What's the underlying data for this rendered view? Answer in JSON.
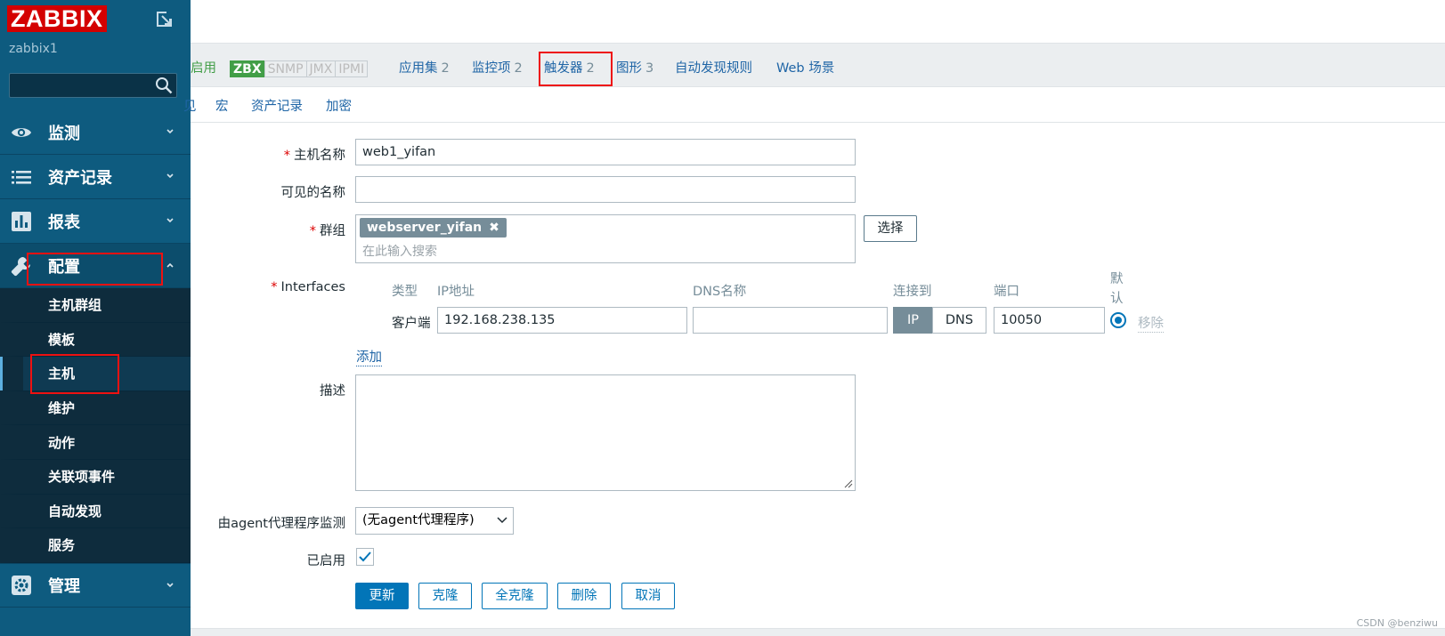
{
  "sidebar": {
    "logo": "ZABBIX",
    "server_name": "zabbix1",
    "search_placeholder": "",
    "menu": [
      {
        "label": "监测",
        "icon": "eye-icon"
      },
      {
        "label": "资产记录",
        "icon": "list-icon"
      },
      {
        "label": "报表",
        "icon": "bar-chart-icon"
      },
      {
        "label": "配置",
        "icon": "wrench-icon"
      },
      {
        "label": "管理",
        "icon": "gear-icon"
      }
    ],
    "config_submenu": [
      "主机群组",
      "模板",
      "主机",
      "维护",
      "动作",
      "关联项事件",
      "自动发现",
      "服务"
    ],
    "selected_submenu": "主机"
  },
  "tabs_row1": {
    "enabled_text": "启用",
    "availability": [
      "ZBX",
      "SNMP",
      "JMX",
      "IPMI"
    ],
    "items": [
      {
        "label": "应用集",
        "count": "2"
      },
      {
        "label": "监控项",
        "count": "2"
      },
      {
        "label": "触发器",
        "count": "2"
      },
      {
        "label": "图形",
        "count": "3"
      },
      {
        "label": "自动发现规则",
        "count": ""
      },
      {
        "label": "Web 场景",
        "count": ""
      }
    ]
  },
  "tabs_row2": {
    "partial": "见",
    "items": [
      "宏",
      "资产记录",
      "加密"
    ]
  },
  "form": {
    "host_name_label": "主机名称",
    "host_name_value": "web1_yifan",
    "visible_name_label": "可见的名称",
    "visible_name_value": "",
    "groups_label": "群组",
    "group_chip": "webserver_yifan",
    "groups_placeholder": "在此输入搜索",
    "select_button": "选择",
    "interfaces_label": "Interfaces",
    "interfaces": {
      "headers": {
        "type": "类型",
        "ip": "IP地址",
        "dns": "DNS名称",
        "connect": "连接到",
        "port": "端口",
        "default": "默认"
      },
      "row": {
        "type": "客户端",
        "ip": "192.168.238.135",
        "dns": "",
        "ip_btn": "IP",
        "dns_btn": "DNS",
        "port": "10050",
        "remove": "移除"
      }
    },
    "add_link": "添加",
    "description_label": "描述",
    "proxy_label": "由agent代理程序监测",
    "proxy_value": "(无agent代理程序)",
    "enabled_label": "已启用",
    "enabled_checked": true,
    "buttons": {
      "update": "更新",
      "clone": "克隆",
      "full_clone": "全克隆",
      "delete": "删除",
      "cancel": "取消"
    }
  },
  "watermark": "CSDN @benziwu",
  "colors": {
    "sidebar": "#0e5b7f",
    "accent": "#0275b8",
    "logo": "#d40000",
    "highlight": "#e11111"
  }
}
